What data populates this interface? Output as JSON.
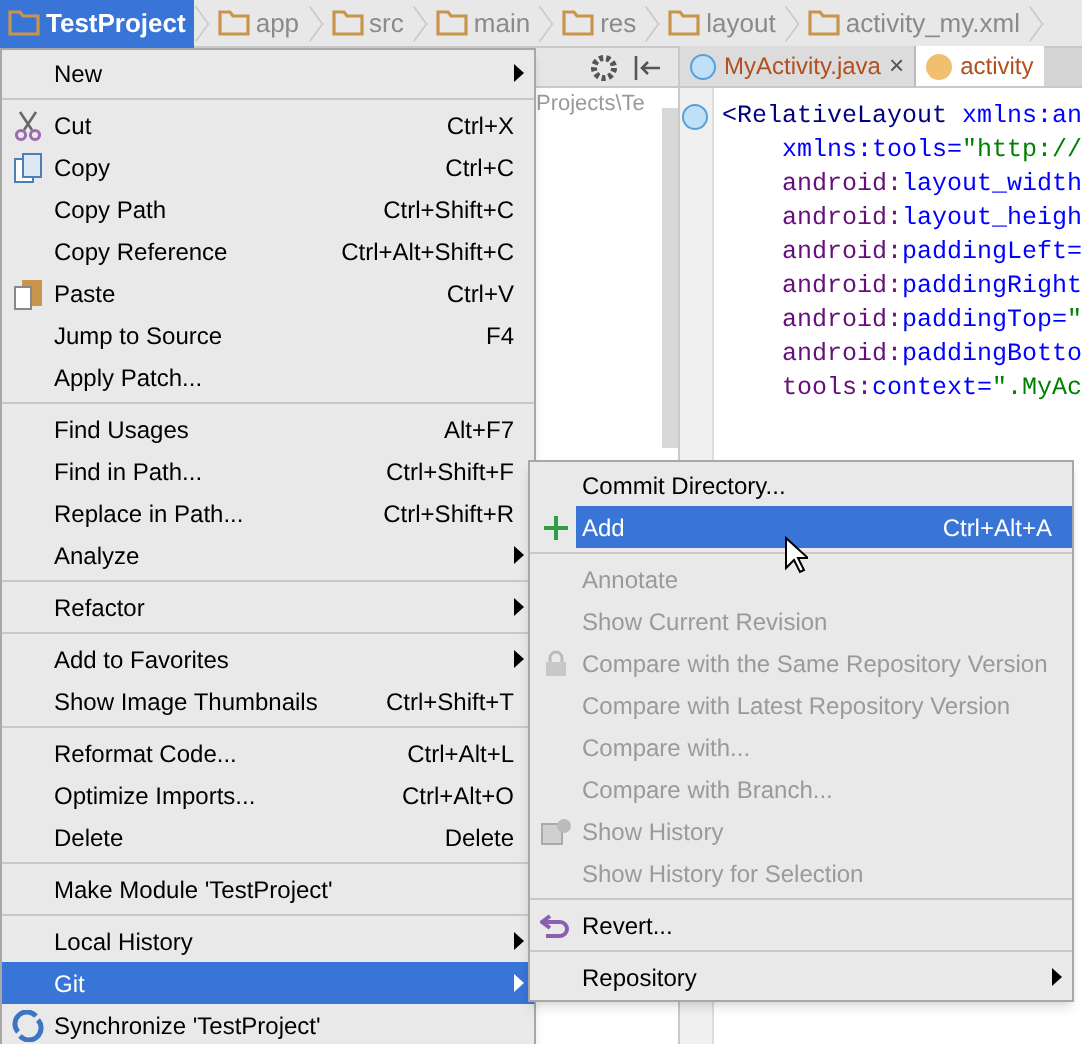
{
  "breadcrumbs": [
    {
      "label": "TestProject",
      "selected": true
    },
    {
      "label": "app",
      "selected": false
    },
    {
      "label": "src",
      "selected": false
    },
    {
      "label": "main",
      "selected": false
    },
    {
      "label": "res",
      "selected": false
    },
    {
      "label": "layout",
      "selected": false
    },
    {
      "label": "activity_my.xml",
      "selected": false
    }
  ],
  "editor_tabs": [
    {
      "label": "MyActivity.java",
      "selected": false,
      "close": "×"
    },
    {
      "label": "activity",
      "selected": true
    }
  ],
  "project_panel": {
    "path": "Projects\\Te"
  },
  "code_lines": [
    [
      {
        "kind": "tag",
        "text": "<RelativeLayout"
      },
      {
        "kind": "attr",
        "text": " xmlns:an"
      }
    ],
    [
      {
        "kind": "attr",
        "text": "    xmlns:tools="
      },
      {
        "kind": "value",
        "text": "\"http://"
      }
    ],
    [
      {
        "kind": "ns",
        "text": "    android:"
      },
      {
        "kind": "attr",
        "text": "layout_width"
      }
    ],
    [
      {
        "kind": "ns",
        "text": "    android:"
      },
      {
        "kind": "attr",
        "text": "layout_heigh"
      }
    ],
    [
      {
        "kind": "ns",
        "text": "    android:"
      },
      {
        "kind": "attr",
        "text": "paddingLeft="
      }
    ],
    [
      {
        "kind": "ns",
        "text": "    android:"
      },
      {
        "kind": "attr",
        "text": "paddingRight"
      }
    ],
    [
      {
        "kind": "ns",
        "text": "    android:"
      },
      {
        "kind": "attr",
        "text": "paddingTop="
      },
      {
        "kind": "value",
        "text": "\""
      }
    ],
    [
      {
        "kind": "ns",
        "text": "    android:"
      },
      {
        "kind": "attr",
        "text": "paddingBotto"
      }
    ],
    [
      {
        "kind": "ns",
        "text": "    tools:"
      },
      {
        "kind": "attr",
        "text": "context="
      },
      {
        "kind": "value",
        "text": "\".MyAc"
      }
    ]
  ],
  "context_menu": [
    {
      "kind": "item",
      "label": "New",
      "submenu": true,
      "selected": false
    },
    {
      "kind": "separator"
    },
    {
      "kind": "item",
      "label": "Cut",
      "shortcut": "Ctrl+X",
      "selected": false
    },
    {
      "kind": "item",
      "label": "Copy",
      "shortcut": "Ctrl+C",
      "selected": false
    },
    {
      "kind": "item",
      "label": "Copy Path",
      "shortcut": "Ctrl+Shift+C",
      "selected": false
    },
    {
      "kind": "item",
      "label": "Copy Reference",
      "shortcut": "Ctrl+Alt+Shift+C",
      "selected": false
    },
    {
      "kind": "item",
      "label": "Paste",
      "shortcut": "Ctrl+V",
      "selected": false
    },
    {
      "kind": "item",
      "label": "Jump to Source",
      "shortcut": "F4",
      "selected": false
    },
    {
      "kind": "item",
      "label": "Apply Patch...",
      "selected": false
    },
    {
      "kind": "separator"
    },
    {
      "kind": "item",
      "label": "Find Usages",
      "shortcut": "Alt+F7",
      "selected": false
    },
    {
      "kind": "item",
      "label": "Find in Path...",
      "shortcut": "Ctrl+Shift+F",
      "selected": false
    },
    {
      "kind": "item",
      "label": "Replace in Path...",
      "shortcut": "Ctrl+Shift+R",
      "selected": false
    },
    {
      "kind": "item",
      "label": "Analyze",
      "submenu": true,
      "selected": false
    },
    {
      "kind": "separator"
    },
    {
      "kind": "item",
      "label": "Refactor",
      "submenu": true,
      "selected": false
    },
    {
      "kind": "separator"
    },
    {
      "kind": "item",
      "label": "Add to Favorites",
      "submenu": true,
      "selected": false
    },
    {
      "kind": "item",
      "label": "Show Image Thumbnails",
      "shortcut": "Ctrl+Shift+T",
      "selected": false
    },
    {
      "kind": "separator"
    },
    {
      "kind": "item",
      "label": "Reformat Code...",
      "shortcut": "Ctrl+Alt+L",
      "selected": false
    },
    {
      "kind": "item",
      "label": "Optimize Imports...",
      "shortcut": "Ctrl+Alt+O",
      "selected": false
    },
    {
      "kind": "item",
      "label": "Delete",
      "shortcut": "Delete",
      "selected": false
    },
    {
      "kind": "separator"
    },
    {
      "kind": "item",
      "label": "Make Module 'TestProject'",
      "selected": false
    },
    {
      "kind": "separator"
    },
    {
      "kind": "item",
      "label": "Local History",
      "submenu": true,
      "selected": false
    },
    {
      "kind": "item",
      "label": "Git",
      "submenu": true,
      "selected": true
    },
    {
      "kind": "item",
      "label": "Synchronize 'TestProject'",
      "selected": false
    }
  ],
  "git_submenu": [
    {
      "kind": "item",
      "label": "Commit Directory...",
      "selected": false,
      "disabled": false
    },
    {
      "kind": "item",
      "label": "Add",
      "shortcut": "Ctrl+Alt+A",
      "selected": true,
      "disabled": false
    },
    {
      "kind": "separator"
    },
    {
      "kind": "item",
      "label": "Annotate",
      "selected": false,
      "disabled": true
    },
    {
      "kind": "item",
      "label": "Show Current Revision",
      "selected": false,
      "disabled": true
    },
    {
      "kind": "item",
      "label": "Compare with the Same Repository Version",
      "selected": false,
      "disabled": true
    },
    {
      "kind": "item",
      "label": "Compare with Latest Repository Version",
      "selected": false,
      "disabled": true
    },
    {
      "kind": "item",
      "label": "Compare with...",
      "selected": false,
      "disabled": true
    },
    {
      "kind": "item",
      "label": "Compare with Branch...",
      "selected": false,
      "disabled": true
    },
    {
      "kind": "item",
      "label": "Show History",
      "selected": false,
      "disabled": true
    },
    {
      "kind": "item",
      "label": "Show History for Selection",
      "selected": false,
      "disabled": true
    },
    {
      "kind": "separator"
    },
    {
      "kind": "item",
      "label": "Revert...",
      "selected": false,
      "disabled": false
    },
    {
      "kind": "separator"
    },
    {
      "kind": "item",
      "label": "Repository",
      "submenu": true,
      "selected": false,
      "disabled": false
    }
  ]
}
